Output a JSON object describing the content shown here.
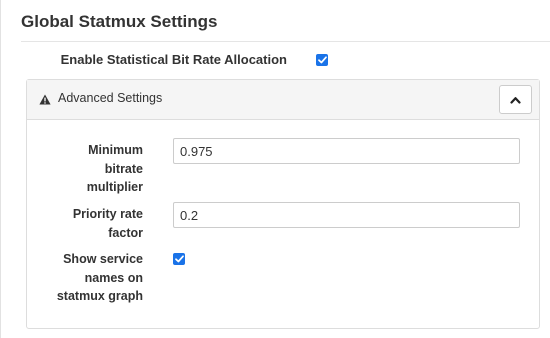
{
  "section": {
    "title": "Global Statmux Settings"
  },
  "enable_allocation": {
    "label": "Enable Statistical Bit Rate Allocation",
    "checked": true
  },
  "advanced_panel": {
    "title": "Advanced Settings",
    "icon": "warning-icon",
    "collapse_icon": "chevron-up-icon",
    "fields": {
      "min_bitrate": {
        "label_lines": [
          "Minimum",
          "bitrate",
          "multiplier"
        ],
        "value": "0.975"
      },
      "priority_rate": {
        "label_lines": [
          "Priority rate",
          "factor"
        ],
        "value": "0.2"
      },
      "show_service_names": {
        "label_lines": [
          "Show service",
          "names on",
          "statmux graph"
        ],
        "checked": true
      }
    }
  },
  "colors": {
    "checkbox_accent": "#1a73e8",
    "panel_heading_bg": "#f5f5f5",
    "border": "#dddddd"
  }
}
